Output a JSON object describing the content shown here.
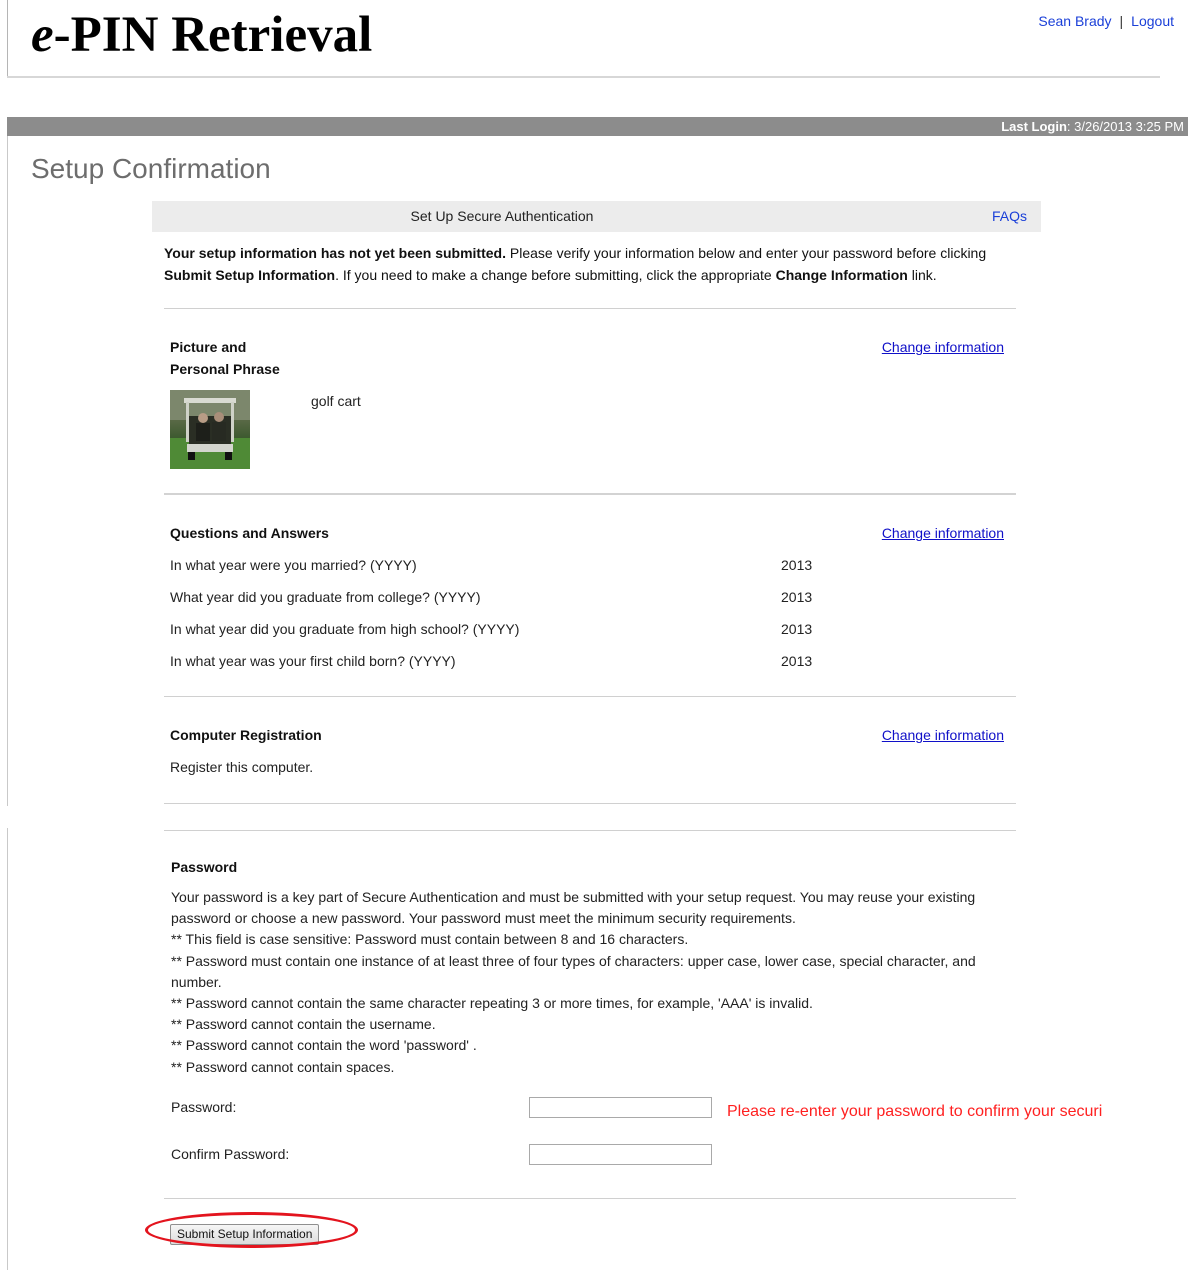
{
  "header": {
    "title_prefix": "e",
    "title_rest": "-PIN Retrieval",
    "user_name": "Sean Brady",
    "separator": "|",
    "logout_label": "Logout"
  },
  "status": {
    "last_login_label": "Last Login",
    "last_login_value": ": 3/26/2013 3:25 PM"
  },
  "page": {
    "heading": "Setup Confirmation",
    "section_title": "Set Up Secure Authentication",
    "faq_label": "FAQs",
    "intro_bold": "Your setup information has not yet been submitted.",
    "intro_1": " Please verify your information below and enter your password before clicking ",
    "intro_submit": "Submit Setup Information",
    "intro_2": ". If you need to make a change before submitting, click the appropriate ",
    "intro_change": "Change Information",
    "intro_3": " link."
  },
  "picture": {
    "title_line1": "Picture and",
    "title_line2": "Personal Phrase",
    "change_label": "Change information",
    "phrase": "golf cart"
  },
  "qa": {
    "title": "Questions and Answers",
    "change_label": "Change information",
    "rows": [
      {
        "q": "In what year were you married? (YYYY)",
        "a": "2013"
      },
      {
        "q": "What year did you graduate from college? (YYYY)",
        "a": "2013"
      },
      {
        "q": "In what year did you graduate from high school? (YYYY)",
        "a": "2013"
      },
      {
        "q": "In what year was your first child born? (YYYY)",
        "a": "2013"
      }
    ]
  },
  "computer": {
    "title": "Computer Registration",
    "change_label": "Change information",
    "text": "Register this computer."
  },
  "password": {
    "title": "Password",
    "lines": [
      "Your password is a key part of Secure Authentication and must be submitted with your setup request. You may reuse your existing password or choose a new password. Your password must meet the minimum security requirements.",
      "** This field is case sensitive: Password must contain between 8 and 16 characters.",
      "** Password must contain one instance of at least three of four types of characters: upper case, lower case, special character, and number.",
      "** Password cannot contain the same character repeating 3 or more times, for example, 'AAA' is invalid.",
      "** Password cannot contain the username.",
      "** Password cannot contain the word 'password' .",
      "** Password cannot contain spaces."
    ],
    "password_label": "Password:",
    "password_value": "",
    "confirm_label": "Confirm Password:",
    "confirm_value": "",
    "hint": "Please re-enter your password to confirm your securi"
  },
  "submit": {
    "label": "Submit Setup Information"
  },
  "colors": {
    "link": "#1a3fd8",
    "status_bar": "#8c8c8c",
    "hint": "#ff2020",
    "highlight_ring": "#e3141e"
  }
}
